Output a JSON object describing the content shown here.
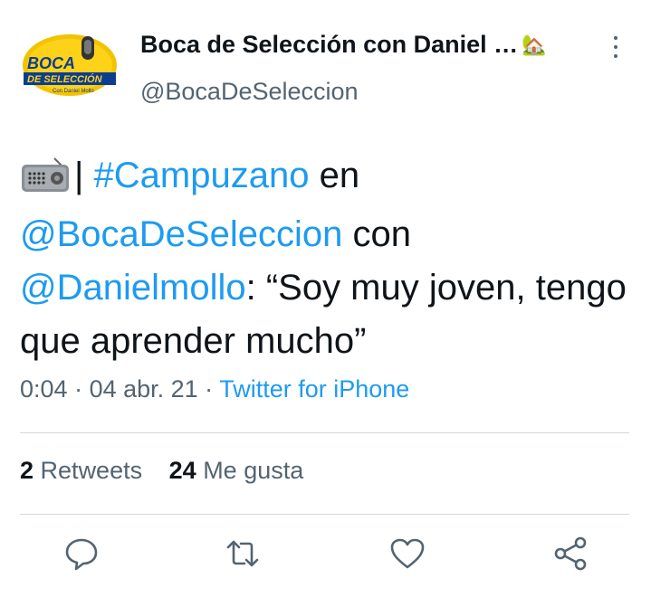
{
  "header": {
    "display_name": "Boca de Selección con Daniel …",
    "name_emoji": "🏡",
    "handle": "@BocaDeSeleccion",
    "avatar_logo": {
      "line1": "BOCA",
      "line2": "DE SELECCIÓN",
      "line3": "Con Daniel Mollo"
    },
    "more_icon": "more-vertical-icon"
  },
  "tweet": {
    "radio_icon": "radio-icon",
    "separator": "|",
    "hashtag": "#Campuzano",
    "t1": " en ",
    "mention1": "@BocaDeSeleccion",
    "t2": " con ",
    "mention2": "@Danielmollo",
    "t3": ": “Soy muy joven, tengo que aprender mucho”"
  },
  "meta": {
    "time": "0:04",
    "sep1": " · ",
    "date": "04 abr. 21",
    "sep2": " · ",
    "source": "Twitter for iPhone"
  },
  "stats": {
    "retweets_count": "2",
    "retweets_label": "Retweets",
    "likes_count": "24",
    "likes_label": "Me gusta"
  },
  "actions": [
    "reply-icon",
    "retweet-icon",
    "like-icon",
    "share-icon"
  ],
  "colors": {
    "link": "#1d9bf0",
    "secondary": "#536471",
    "text": "#0f1419",
    "divider": "#cfd9de"
  }
}
